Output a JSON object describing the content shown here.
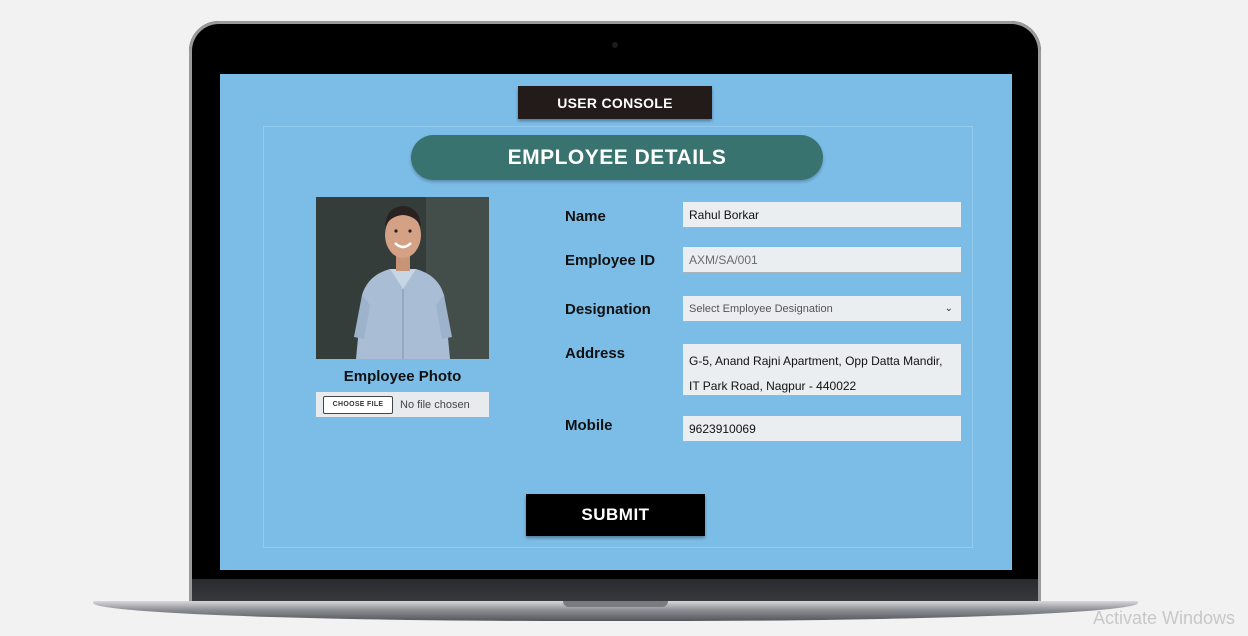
{
  "header": {
    "console_label": "USER CONSOLE"
  },
  "form": {
    "title": "EMPLOYEE DETAILS",
    "photo_label": "Employee Photo",
    "file_input": {
      "button_label": "CHOOSE FILE",
      "status": "No file chosen"
    },
    "fields": {
      "name": {
        "label": "Name",
        "value": "Rahul Borkar"
      },
      "employee_id": {
        "label": "Employee ID",
        "placeholder": "AXM/SA/001"
      },
      "designation": {
        "label": "Designation",
        "selected": "Select Employee Designation"
      },
      "address": {
        "label": "Address",
        "line1": "G-5, Anand Rajni Apartment, Opp Datta Mandir,",
        "line2": "IT Park Road, Nagpur - 440022"
      },
      "mobile": {
        "label": "Mobile",
        "value": "9623910069"
      }
    },
    "submit_label": "SUBMIT"
  },
  "os": {
    "watermark": "Activate Windows"
  },
  "colors": {
    "screen_bg": "#7cbde8",
    "title_pill": "#39736f",
    "console_button": "#231a1a",
    "submit_button": "#000000"
  }
}
